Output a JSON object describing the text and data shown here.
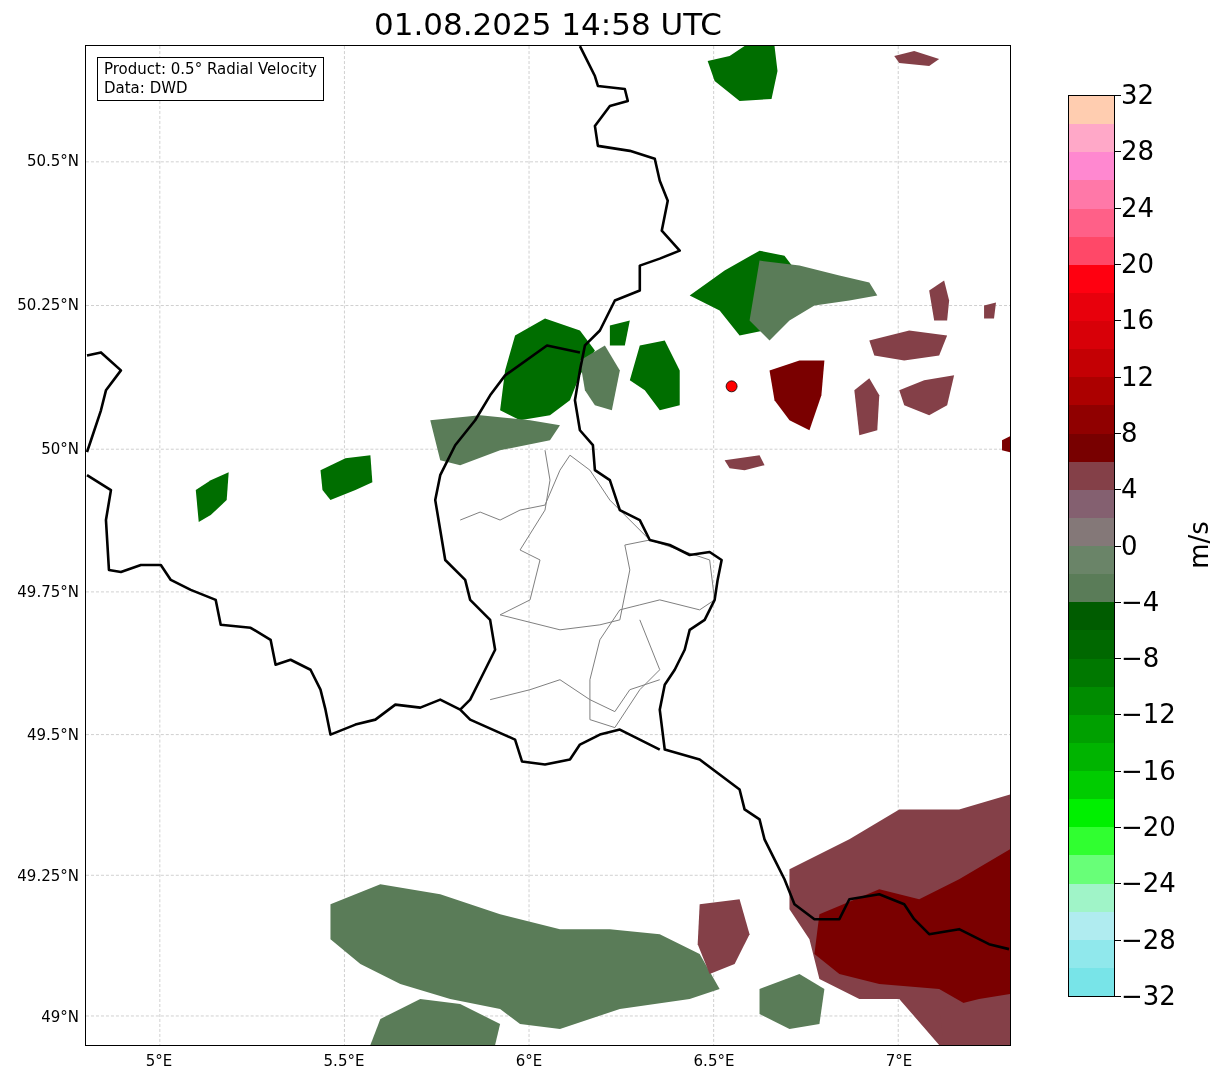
{
  "title": "01.08.2025 14:58 UTC",
  "legend": [
    "Product: 0.5° Radial Velocity",
    "Data: DWD"
  ],
  "map": {
    "xticks": [
      "5°E",
      "5.5°E",
      "6°E",
      "6.5°E",
      "7°E"
    ],
    "yticks": [
      "50.5°N",
      "50.25°N",
      "50°N",
      "49.75°N",
      "49.5°N",
      "49.25°N",
      "49°N"
    ]
  },
  "colorbar": {
    "label": "m/s",
    "ticks": [
      "32",
      "28",
      "24",
      "20",
      "16",
      "12",
      "8",
      "4",
      "0",
      "−4",
      "−8",
      "−12",
      "−16",
      "−20",
      "−24",
      "−28",
      "−32"
    ],
    "bands": [
      {
        "color": "#ffcdb0"
      },
      {
        "color": "#ffa8c8"
      },
      {
        "color": "#ff88d0"
      },
      {
        "color": "#ff78a8"
      },
      {
        "color": "#ff6088"
      },
      {
        "color": "#ff4868"
      },
      {
        "color": "#ff0010"
      },
      {
        "color": "#e8000c"
      },
      {
        "color": "#d80008"
      },
      {
        "color": "#c40004"
      },
      {
        "color": "#ac0000"
      },
      {
        "color": "#900000"
      },
      {
        "color": "#780000"
      },
      {
        "color": "#844048"
      },
      {
        "color": "#846070"
      },
      {
        "color": "#847878"
      },
      {
        "color": "#6a8468"
      },
      {
        "color": "#5a7c58"
      },
      {
        "color": "#005c00"
      },
      {
        "color": "#006800"
      },
      {
        "color": "#007800"
      },
      {
        "color": "#008c00"
      },
      {
        "color": "#00a000"
      },
      {
        "color": "#00b400"
      },
      {
        "color": "#00cc00"
      },
      {
        "color": "#00f000"
      },
      {
        "color": "#30ff30"
      },
      {
        "color": "#68ff78"
      },
      {
        "color": "#a0f4c8"
      },
      {
        "color": "#b0ecf0"
      },
      {
        "color": "#90e8ec"
      },
      {
        "color": "#78e4e8"
      }
    ]
  }
}
